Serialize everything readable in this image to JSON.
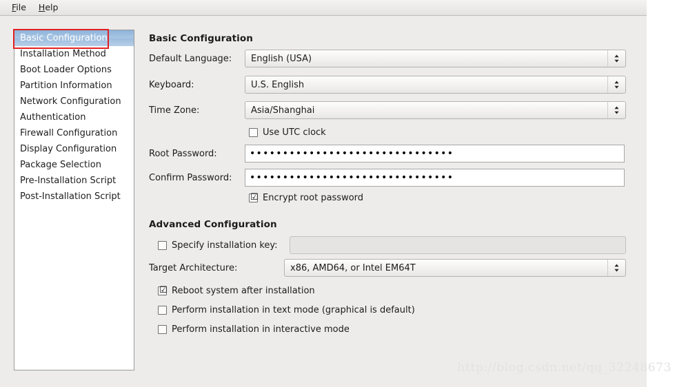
{
  "window": {
    "background_color": "#edecea"
  },
  "menubar": {
    "items": [
      {
        "label": "File",
        "mnemonic": "F",
        "rest": "ile"
      },
      {
        "label": "Help",
        "mnemonic": "H",
        "rest": "elp"
      }
    ]
  },
  "sidebar": {
    "selected_index": 0,
    "selection_color": "#9dbcdd",
    "items": [
      {
        "label": "Basic Configuration"
      },
      {
        "label": "Installation Method"
      },
      {
        "label": "Boot Loader Options"
      },
      {
        "label": "Partition Information"
      },
      {
        "label": "Network Configuration"
      },
      {
        "label": "Authentication"
      },
      {
        "label": "Firewall Configuration"
      },
      {
        "label": "Display Configuration"
      },
      {
        "label": "Package Selection"
      },
      {
        "label": "Pre-Installation Script"
      },
      {
        "label": "Post-Installation Script"
      }
    ]
  },
  "annotation": {
    "color": "#e02020",
    "target": "Basic Configuration"
  },
  "main": {
    "basic": {
      "title": "Basic Configuration",
      "default_language": {
        "label": "Default Language:",
        "value": "English (USA)",
        "icon": "spinner-chevrons-icon"
      },
      "keyboard": {
        "label": "Keyboard:",
        "value": "U.S. English",
        "icon": "spinner-chevrons-icon"
      },
      "time_zone": {
        "label": "Time Zone:",
        "value": "Asia/Shanghai",
        "icon": "spinner-chevrons-icon"
      },
      "use_utc_clock": {
        "label": "Use UTC clock",
        "checked": false,
        "mark": ""
      },
      "root_password": {
        "label": "Root Password:",
        "value": "•••••••••••••••••••••••••••••••",
        "placeholder": ""
      },
      "confirm_password": {
        "label": "Confirm Password:",
        "value": "•••••••••••••••••••••••••••••••",
        "placeholder": ""
      },
      "encrypt_root_password": {
        "label": "Encrypt root password",
        "checked": true,
        "mark": "☑"
      }
    },
    "advanced": {
      "title": "Advanced Configuration",
      "specify_installation_key": {
        "label": "Specify installation key:",
        "checked": false,
        "mark": "",
        "field_value": "",
        "field_placeholder": "",
        "field_disabled": true
      },
      "target_architecture": {
        "label": "Target Architecture:",
        "value": "x86, AMD64, or Intel EM64T",
        "icon": "spinner-chevrons-icon"
      },
      "reboot_after_install": {
        "label": "Reboot system after installation",
        "checked": true,
        "mark": "☑"
      },
      "text_mode_install": {
        "label": "Perform installation in text mode (graphical is default)",
        "checked": false,
        "mark": ""
      },
      "interactive_mode_install": {
        "label": "Perform installation in interactive mode",
        "checked": false,
        "mark": ""
      }
    }
  },
  "watermark": {
    "text": "http://blog.csdn.net/qq_32248673"
  }
}
